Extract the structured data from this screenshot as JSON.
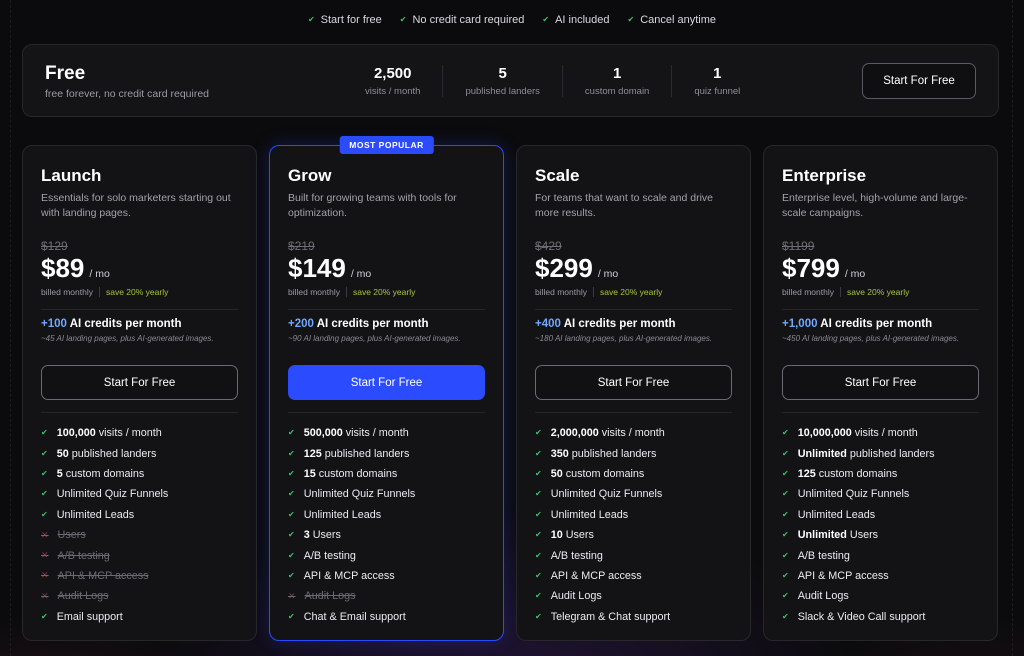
{
  "perks": [
    "Start for free",
    "No credit card required",
    "AI included",
    "Cancel anytime"
  ],
  "free": {
    "title": "Free",
    "subtitle": "free forever, no credit card required",
    "stats": [
      {
        "value": "2,500",
        "label": "visits / month"
      },
      {
        "value": "5",
        "label": "published landers"
      },
      {
        "value": "1",
        "label": "custom domain"
      },
      {
        "value": "1",
        "label": "quiz funnel"
      }
    ],
    "button": "Start For Free"
  },
  "common": {
    "per": "/ mo",
    "billed": "billed monthly",
    "save": "save 20% yearly",
    "credits_suffix": "AI credits per month",
    "cta": "Start For Free",
    "badge": "MOST POPULAR"
  },
  "plans": [
    {
      "name": "Launch",
      "desc": "Essentials for solo marketers starting out with landing pages.",
      "old_price": "$129",
      "price": "$89",
      "credits": "+100",
      "credits_sub": "~45 AI landing pages, plus AI-generated images.",
      "features": [
        {
          "bold": "100,000",
          "text": "visits / month",
          "on": true
        },
        {
          "bold": "50",
          "text": "published landers",
          "on": true
        },
        {
          "bold": "5",
          "text": "custom domains",
          "on": true
        },
        {
          "bold": "",
          "text": "Unlimited Quiz Funnels",
          "on": true
        },
        {
          "bold": "",
          "text": "Unlimited Leads",
          "on": true
        },
        {
          "bold": "",
          "text": "Users",
          "on": false
        },
        {
          "bold": "",
          "text": "A/B testing",
          "on": false
        },
        {
          "bold": "",
          "text": "API & MCP access",
          "on": false
        },
        {
          "bold": "",
          "text": "Audit Logs",
          "on": false
        },
        {
          "bold": "",
          "text": "Email support",
          "on": true
        }
      ]
    },
    {
      "name": "Grow",
      "desc": "Built for growing teams with tools for optimization.",
      "old_price": "$219",
      "price": "$149",
      "credits": "+200",
      "credits_sub": "~90 AI landing pages, plus AI-generated images.",
      "features": [
        {
          "bold": "500,000",
          "text": "visits / month",
          "on": true
        },
        {
          "bold": "125",
          "text": "published landers",
          "on": true
        },
        {
          "bold": "15",
          "text": "custom domains",
          "on": true
        },
        {
          "bold": "",
          "text": "Unlimited Quiz Funnels",
          "on": true
        },
        {
          "bold": "",
          "text": "Unlimited Leads",
          "on": true
        },
        {
          "bold": "3",
          "text": "Users",
          "on": true
        },
        {
          "bold": "",
          "text": "A/B testing",
          "on": true
        },
        {
          "bold": "",
          "text": "API & MCP access",
          "on": true
        },
        {
          "bold": "",
          "text": "Audit Logs",
          "on": false
        },
        {
          "bold": "",
          "text": "Chat & Email support",
          "on": true
        }
      ]
    },
    {
      "name": "Scale",
      "desc": "For teams that want to scale and drive more results.",
      "old_price": "$429",
      "price": "$299",
      "credits": "+400",
      "credits_sub": "~180 AI landing pages, plus AI-generated images.",
      "features": [
        {
          "bold": "2,000,000",
          "text": "visits / month",
          "on": true
        },
        {
          "bold": "350",
          "text": "published landers",
          "on": true
        },
        {
          "bold": "50",
          "text": "custom domains",
          "on": true
        },
        {
          "bold": "",
          "text": "Unlimited Quiz Funnels",
          "on": true
        },
        {
          "bold": "",
          "text": "Unlimited Leads",
          "on": true
        },
        {
          "bold": "10",
          "text": "Users",
          "on": true
        },
        {
          "bold": "",
          "text": "A/B testing",
          "on": true
        },
        {
          "bold": "",
          "text": "API & MCP access",
          "on": true
        },
        {
          "bold": "",
          "text": "Audit Logs",
          "on": true
        },
        {
          "bold": "",
          "text": "Telegram & Chat support",
          "on": true
        }
      ]
    },
    {
      "name": "Enterprise",
      "desc": "Enterprise level, high-volume and large-scale campaigns.",
      "old_price": "$1199",
      "price": "$799",
      "credits": "+1,000",
      "credits_sub": "~450 AI landing pages, plus AI-generated images.",
      "features": [
        {
          "bold": "10,000,000",
          "text": "visits / month",
          "on": true
        },
        {
          "bold": "Unlimited",
          "text": "published landers",
          "on": true
        },
        {
          "bold": "125",
          "text": "custom domains",
          "on": true
        },
        {
          "bold": "",
          "text": "Unlimited Quiz Funnels",
          "on": true
        },
        {
          "bold": "",
          "text": "Unlimited Leads",
          "on": true
        },
        {
          "bold": "Unlimited",
          "text": "Users",
          "on": true
        },
        {
          "bold": "",
          "text": "A/B testing",
          "on": true
        },
        {
          "bold": "",
          "text": "API & MCP access",
          "on": true
        },
        {
          "bold": "",
          "text": "Audit Logs",
          "on": true
        },
        {
          "bold": "",
          "text": "Slack & Video Call support",
          "on": true
        }
      ]
    }
  ],
  "colors": {
    "accent": "#2b4bff",
    "check": "#3fbf6e",
    "save": "#a7c43a",
    "credits": "#6ea8ff"
  }
}
